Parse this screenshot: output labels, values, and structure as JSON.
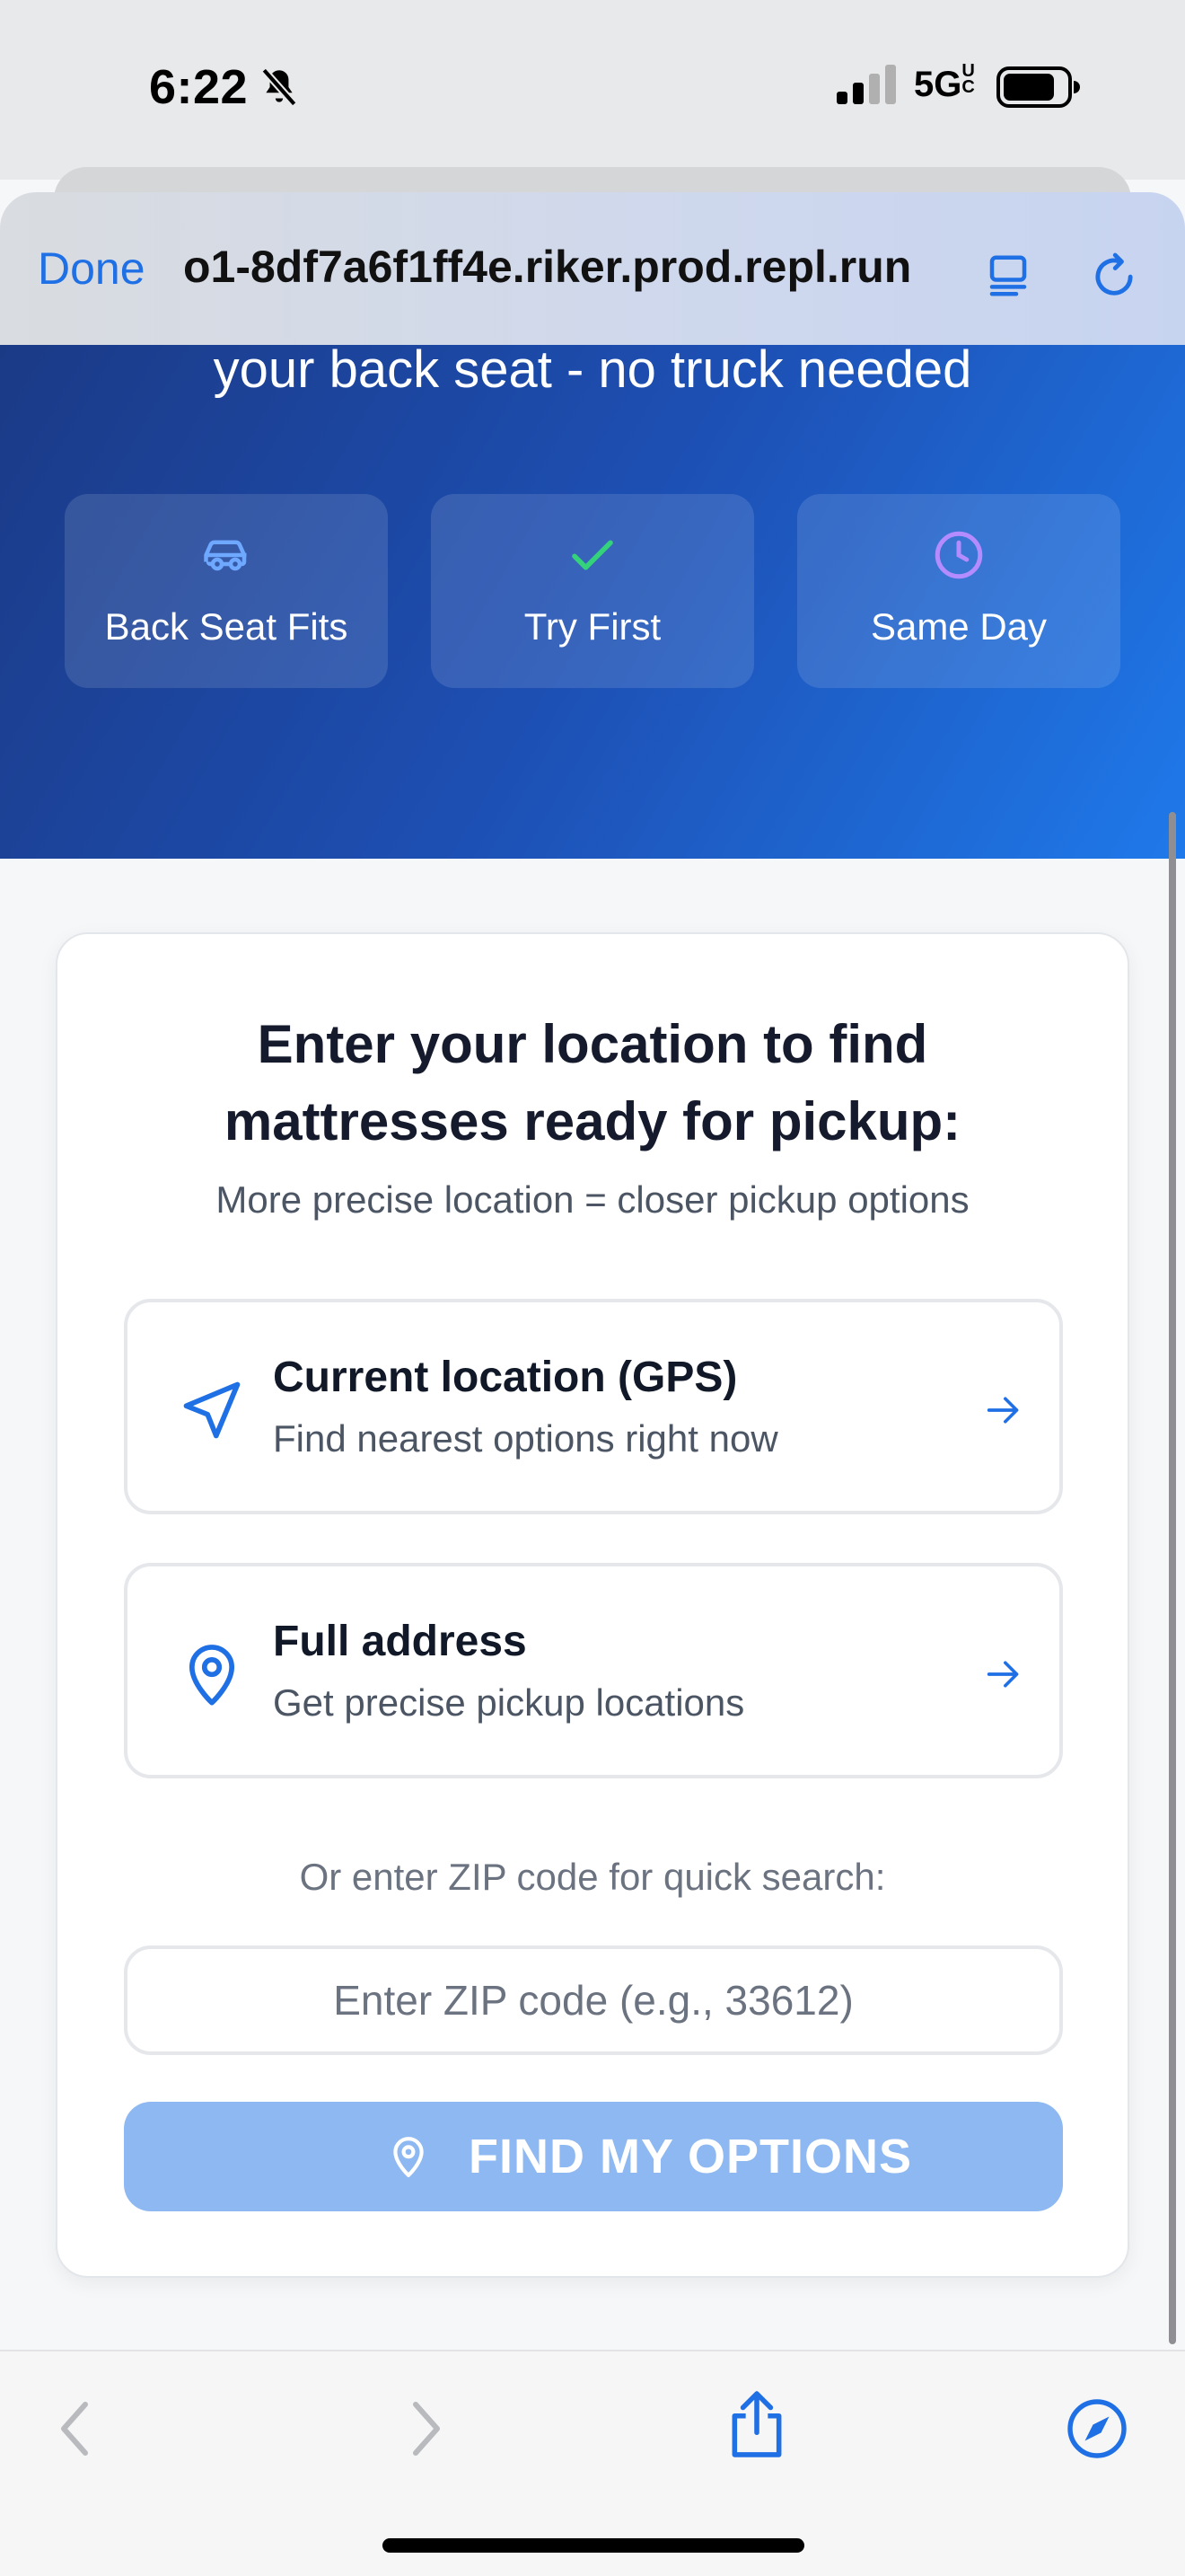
{
  "status_bar": {
    "time": "6:22",
    "network": "5G",
    "network_badge": "UC"
  },
  "browser": {
    "done_label": "Done",
    "url": "o1-8df7a6f1ff4e.riker.prod.repl.run"
  },
  "hero": {
    "tagline": "your back seat - no truck needed",
    "features": [
      {
        "label": "Back Seat Fits",
        "icon": "car-icon",
        "color": "#6ea8ff"
      },
      {
        "label": "Try First",
        "icon": "check-icon",
        "color": "#34d27b"
      },
      {
        "label": "Same Day",
        "icon": "clock-icon",
        "color": "#b48cff"
      }
    ]
  },
  "card": {
    "title_line1": "Enter your location to find",
    "title_line2": "mattresses ready for pickup:",
    "subtitle": "More precise location = closer pickup options",
    "options": [
      {
        "title": "Current location (GPS)",
        "description": "Find nearest options right now",
        "icon": "navigation-arrow-icon"
      },
      {
        "title": "Full address",
        "description": "Get precise pickup locations",
        "icon": "map-pin-icon"
      }
    ],
    "zip_label": "Or enter ZIP code for quick search:",
    "zip_placeholder": "Enter ZIP code (e.g., 33612)",
    "zip_value": "",
    "find_button": "FIND MY OPTIONS"
  },
  "colors": {
    "accent": "#1f6fe5",
    "button_disabled": "#8db8f1",
    "hero_start": "#1b3a86",
    "hero_end": "#1f79ea"
  }
}
